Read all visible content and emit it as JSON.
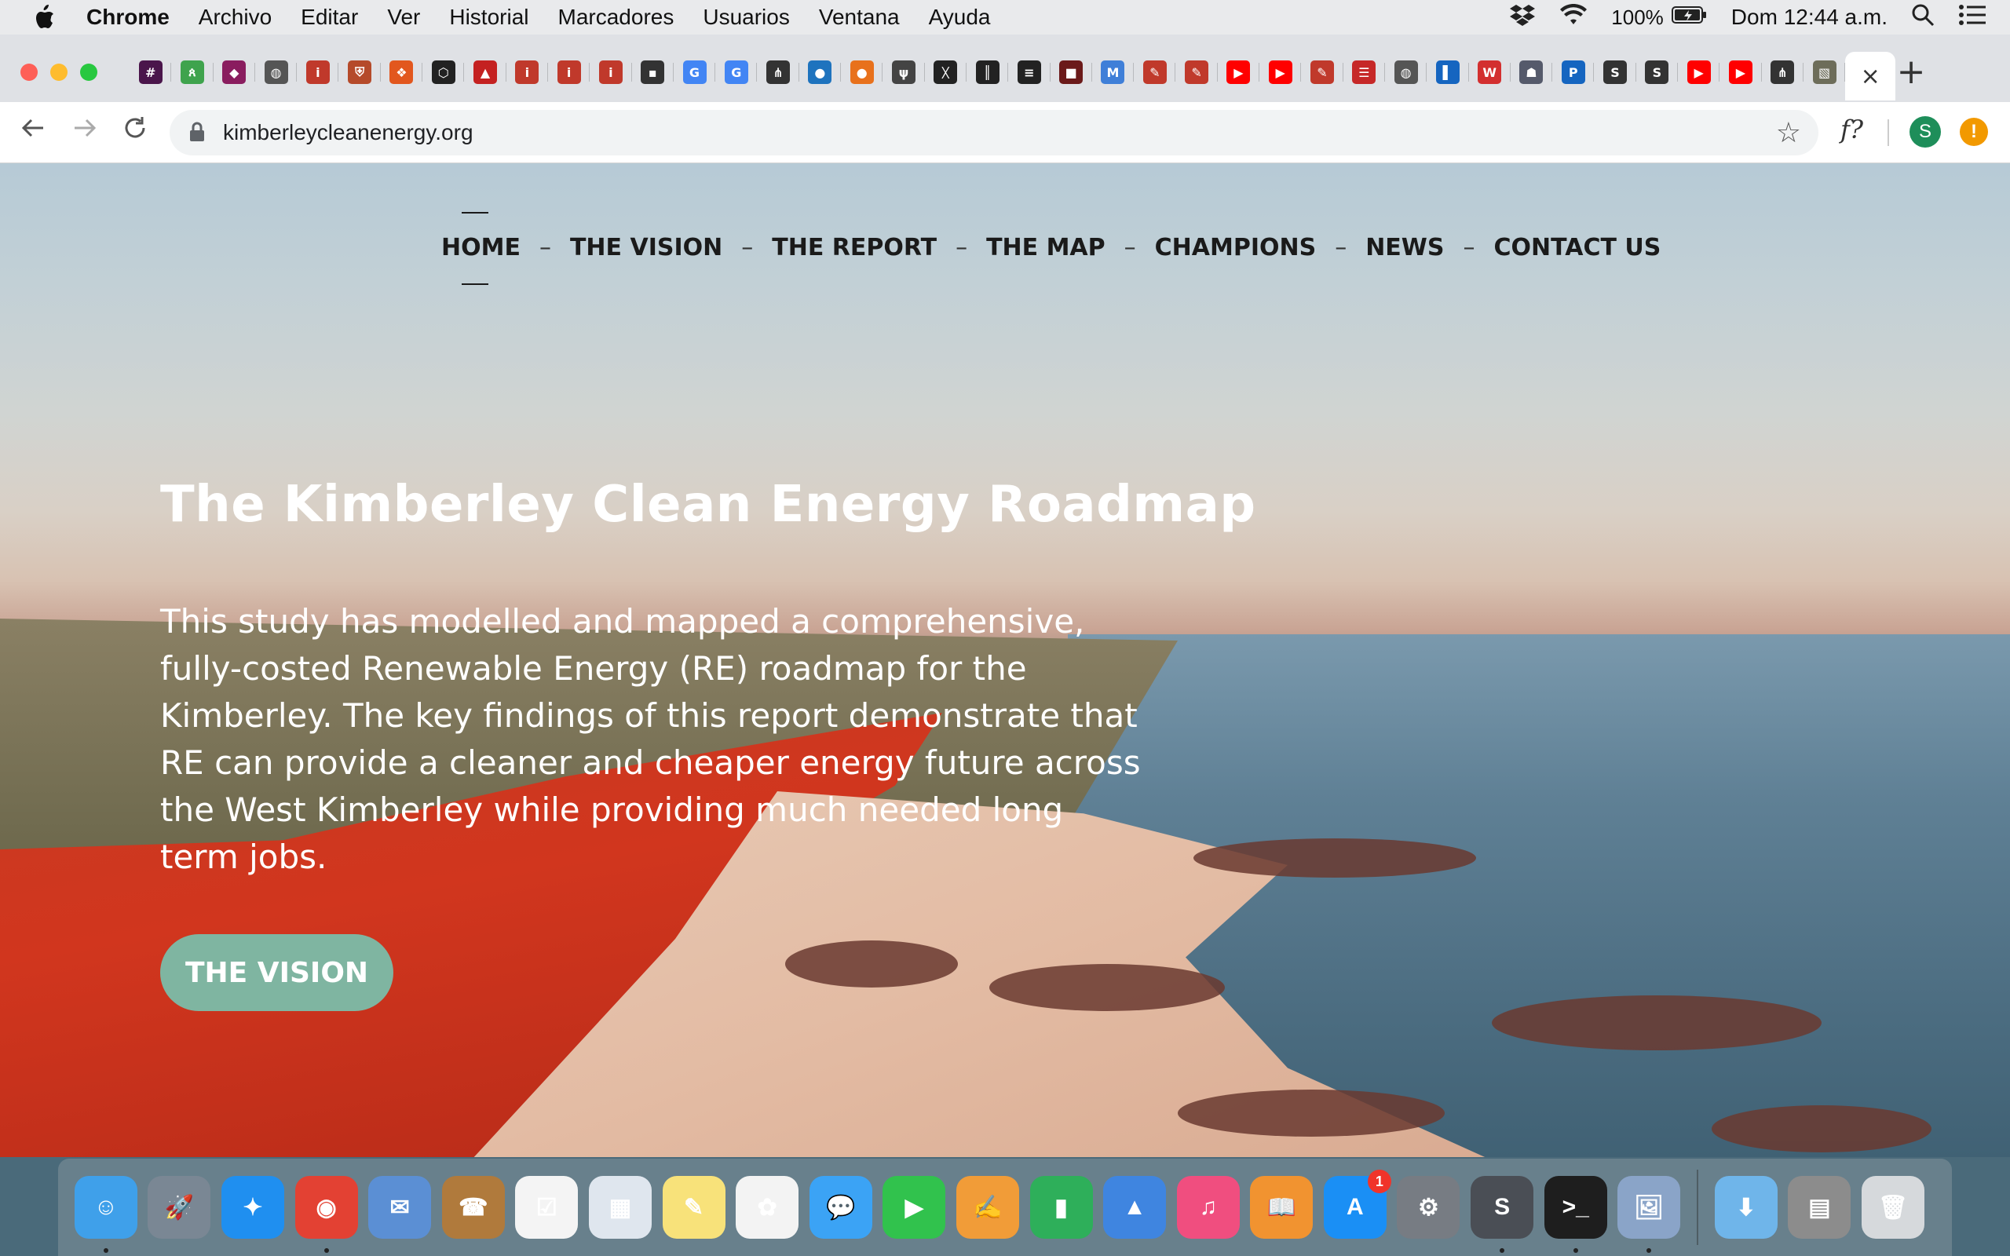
{
  "menubar": {
    "app_name": "Chrome",
    "items": [
      "Archivo",
      "Editar",
      "Ver",
      "Historial",
      "Marcadores",
      "Usuarios",
      "Ventana",
      "Ayuda"
    ],
    "battery": "100%",
    "clock": "Dom 12:44 a.m."
  },
  "tabs": [
    {
      "icon": "slack-icon",
      "color": "#4a154b",
      "glyph": "#"
    },
    {
      "icon": "people-icon",
      "color": "#3fa34d",
      "glyph": "ጰ"
    },
    {
      "icon": "shield-icon",
      "color": "#8a1d5f",
      "glyph": "◆"
    },
    {
      "icon": "globe-icon",
      "color": "#555555",
      "glyph": "◍"
    },
    {
      "icon": "italic-i-icon",
      "color": "#c0392b",
      "glyph": "i"
    },
    {
      "icon": "crest-icon",
      "color": "#b54a2a",
      "glyph": "⛨"
    },
    {
      "icon": "fox-icon",
      "color": "#e2571e",
      "glyph": "❖"
    },
    {
      "icon": "codepen-icon",
      "color": "#222222",
      "glyph": "⬡"
    },
    {
      "icon": "triangle-a-icon",
      "color": "#c42121",
      "glyph": "▲"
    },
    {
      "icon": "italic-i-icon",
      "color": "#c0392b",
      "glyph": "i"
    },
    {
      "icon": "italic-i-icon",
      "color": "#c0392b",
      "glyph": "i"
    },
    {
      "icon": "italic-i-icon",
      "color": "#c0392b",
      "glyph": "i"
    },
    {
      "icon": "square-dot-icon",
      "color": "#333333",
      "glyph": "▪"
    },
    {
      "icon": "google-icon",
      "color": "#4285f4",
      "glyph": "G"
    },
    {
      "icon": "google-icon",
      "color": "#4285f4",
      "glyph": "G"
    },
    {
      "icon": "antenna-icon",
      "color": "#333333",
      "glyph": "⋔"
    },
    {
      "icon": "drop-icon",
      "color": "#1e73be",
      "glyph": "●"
    },
    {
      "icon": "orange-circle-icon",
      "color": "#e8711c",
      "glyph": "●"
    },
    {
      "icon": "hand-icon",
      "color": "#444444",
      "glyph": "ψ"
    },
    {
      "icon": "walker-icon",
      "color": "#222222",
      "glyph": "ᚷ"
    },
    {
      "icon": "barcode-icon",
      "color": "#222222",
      "glyph": "║"
    },
    {
      "icon": "menu-lines-icon",
      "color": "#222222",
      "glyph": "≡"
    },
    {
      "icon": "dark-square-icon",
      "color": "#6b1a1a",
      "glyph": "■"
    },
    {
      "icon": "mdb-icon",
      "color": "#3f7fd8",
      "glyph": "M"
    },
    {
      "icon": "pen-icon",
      "color": "#c0392b",
      "glyph": "✎"
    },
    {
      "icon": "pen-icon",
      "color": "#c0392b",
      "glyph": "✎"
    },
    {
      "icon": "youtube-icon",
      "color": "#ff0000",
      "glyph": "▶"
    },
    {
      "icon": "youtube-icon",
      "color": "#ff0000",
      "glyph": "▶"
    },
    {
      "icon": "pen-icon",
      "color": "#c0392b",
      "glyph": "✎"
    },
    {
      "icon": "bars-icon",
      "color": "#c62828",
      "glyph": "☰"
    },
    {
      "icon": "globe-icon",
      "color": "#555555",
      "glyph": "◍"
    },
    {
      "icon": "blue-flag-icon",
      "color": "#1565c0",
      "glyph": "▌"
    },
    {
      "icon": "w-icon",
      "color": "#d32f2f",
      "glyph": "W"
    },
    {
      "icon": "mascot-icon",
      "color": "#555a6b",
      "glyph": "☗"
    },
    {
      "icon": "ptc-icon",
      "color": "#1565c0",
      "glyph": "P"
    },
    {
      "icon": "s-hex-icon",
      "color": "#333333",
      "glyph": "S"
    },
    {
      "icon": "s-hex-icon",
      "color": "#333333",
      "glyph": "S"
    },
    {
      "icon": "youtube-icon",
      "color": "#ff0000",
      "glyph": "▶"
    },
    {
      "icon": "youtube-icon",
      "color": "#ff0000",
      "glyph": "▶"
    },
    {
      "icon": "antenna-icon",
      "color": "#333333",
      "glyph": "⋔"
    },
    {
      "icon": "photo-icon",
      "color": "#6d6d5a",
      "glyph": "▧"
    }
  ],
  "toolbar": {
    "url": "kimberleycleanenergy.org",
    "ext_formula": "f?",
    "profile_initial": "S"
  },
  "site": {
    "nav": [
      "HOME",
      "THE VISION",
      "THE REPORT",
      "THE MAP",
      "CHAMPIONS",
      "NEWS",
      "CONTACT US"
    ],
    "nav_current": "HOME",
    "nav_separator": "–",
    "title": "The Kimberley Clean Energy Roadmap",
    "body": "This study has modelled and mapped a comprehensive, fully-costed Renewable Energy (RE) roadmap for the Kimberley. The key findings of this report demonstrate that RE can provide a cleaner and cheaper energy future across the West Kimberley while providing much needed long term jobs.",
    "button": "THE VISION",
    "button_color": "#7fb5a1"
  },
  "dock": {
    "apps": [
      {
        "name": "finder-icon",
        "color": "#3fa0ea",
        "glyph": "☺",
        "running": true
      },
      {
        "name": "launchpad-icon",
        "color": "#7a8794",
        "glyph": "🚀",
        "running": false
      },
      {
        "name": "safari-icon",
        "color": "#1f8ff0",
        "glyph": "✦",
        "running": false
      },
      {
        "name": "chrome-icon",
        "color": "#e34133",
        "glyph": "◉",
        "running": true
      },
      {
        "name": "mail-icon",
        "color": "#5b8fd4",
        "glyph": "✉",
        "running": false
      },
      {
        "name": "contacts-icon",
        "color": "#b07a3c",
        "glyph": "☎",
        "running": false
      },
      {
        "name": "reminders-icon",
        "color": "#f4f4f4",
        "glyph": "☑",
        "running": false
      },
      {
        "name": "calendar-icon",
        "color": "#dfe6ee",
        "glyph": "▦",
        "running": false
      },
      {
        "name": "notes-icon",
        "color": "#f8e27a",
        "glyph": "✎",
        "running": false
      },
      {
        "name": "photos-icon",
        "color": "#f3f3f3",
        "glyph": "✿",
        "running": false
      },
      {
        "name": "messages-icon",
        "color": "#3ba3f5",
        "glyph": "💬",
        "running": false
      },
      {
        "name": "facetime-icon",
        "color": "#31c24d",
        "glyph": "▶",
        "running": false
      },
      {
        "name": "pages-icon",
        "color": "#f19c38",
        "glyph": "✍",
        "running": false
      },
      {
        "name": "numbers-icon",
        "color": "#2eaf5a",
        "glyph": "▮",
        "running": false
      },
      {
        "name": "keynote-icon",
        "color": "#3f85e0",
        "glyph": "▲",
        "running": false
      },
      {
        "name": "itunes-icon",
        "color": "#f04e7f",
        "glyph": "♫",
        "running": false
      },
      {
        "name": "ibooks-icon",
        "color": "#f19330",
        "glyph": "📖",
        "running": false
      },
      {
        "name": "appstore-icon",
        "color": "#1a8ff5",
        "glyph": "A",
        "running": false,
        "badge": "1"
      },
      {
        "name": "system-preferences-icon",
        "color": "#777c83",
        "glyph": "⚙",
        "running": false
      },
      {
        "name": "sublime-text-icon",
        "color": "#4a4e55",
        "glyph": "S",
        "running": true
      },
      {
        "name": "terminal-icon",
        "color": "#1e1e1e",
        "glyph": ">_",
        "running": true
      },
      {
        "name": "preview-icon",
        "color": "#8aa4c8",
        "glyph": "🖼",
        "running": true
      }
    ],
    "right": [
      {
        "name": "downloads-folder-icon",
        "color": "#6fb5ea",
        "glyph": "⬇"
      },
      {
        "name": "document-stack-icon",
        "color": "#8c8c8c",
        "glyph": "▤"
      },
      {
        "name": "trash-icon",
        "color": "#d6d9dc",
        "glyph": "🗑"
      }
    ]
  }
}
